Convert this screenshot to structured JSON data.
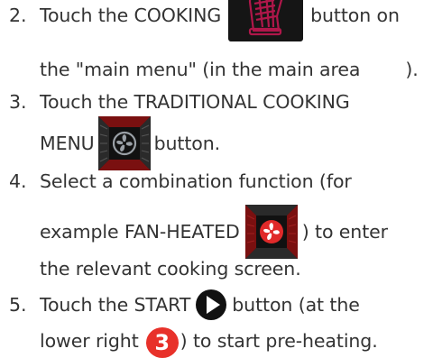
{
  "steps": [
    {
      "number": "2.",
      "line1_before": "Touch the COOKING",
      "line1_after": "button on",
      "line2": "the \"main menu\" (in the main area",
      "line2_end": ").",
      "icon": "cooking-glove-icon"
    },
    {
      "number": "3.",
      "line1": "Touch the TRADITIONAL COOKING",
      "line2_before": "MENU",
      "line2_after": "button.",
      "icon": "traditional-cooking-menu-icon"
    },
    {
      "number": "4.",
      "line1": "Select a combination function (for",
      "line2_before": "example FAN-HEATED",
      "line2_after": ") to enter",
      "line3": "the relevant cooking screen.",
      "icon": "fan-heated-icon"
    },
    {
      "number": "5.",
      "line1_before": "Touch the START",
      "line1_after": "button (at the",
      "line2_before": "lower right",
      "line2_after": ") to start pre-heating.",
      "icon": "start-play-icon",
      "badge": "3"
    }
  ],
  "colors": {
    "text": "#333333",
    "accent_red": "#e8312a",
    "dark": "#151515"
  }
}
